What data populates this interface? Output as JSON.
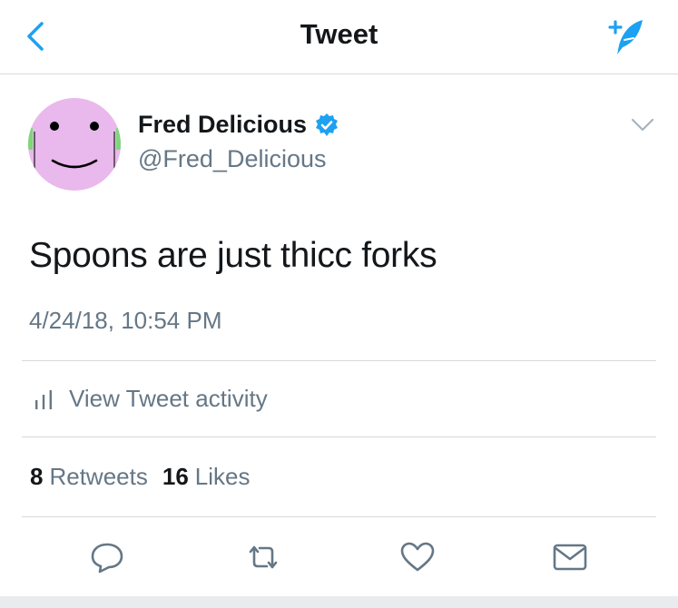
{
  "nav": {
    "title": "Tweet",
    "back_icon": "chevron-left-icon",
    "compose_icon": "compose-tweet-icon",
    "accent": "#1da1f2"
  },
  "author": {
    "name": "Fred Delicious",
    "handle": "@Fred_Delicious",
    "verified": true,
    "verified_color": "#1da1f2",
    "avatar_color": "#e9b8ec"
  },
  "tweet": {
    "text": "Spoons are just thicc forks",
    "timestamp": "4/24/18, 10:54 PM"
  },
  "activity": {
    "label": "View Tweet activity"
  },
  "stats": {
    "retweets_count": "8",
    "retweets_label": "Retweets",
    "likes_count": "16",
    "likes_label": "Likes"
  },
  "actions": [
    "reply-icon",
    "retweet-icon",
    "like-icon",
    "share-icon"
  ]
}
